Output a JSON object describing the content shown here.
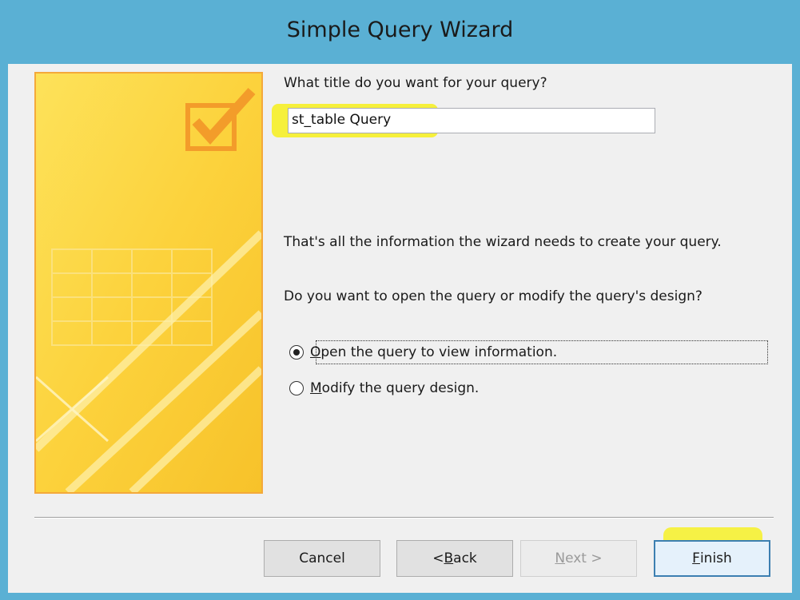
{
  "window": {
    "title": "Simple Query Wizard"
  },
  "prompt": "What title do you want for your query?",
  "query_title": {
    "value": "st_table Query"
  },
  "info": {
    "line1": "That's all the information the wizard needs to create your query.",
    "line2": "Do you want to open the query or modify the query's design?"
  },
  "options": [
    {
      "label_rest": "pen the query to view information.",
      "accel": "O",
      "selected": true
    },
    {
      "label_rest": "odify the query design.",
      "accel": "M",
      "selected": false
    }
  ],
  "buttons": {
    "cancel": "Cancel",
    "back_prefix": "< ",
    "back_accel": "B",
    "back_rest": "ack",
    "next_accel": "N",
    "next_rest": "ext >",
    "finish_accel": "F",
    "finish_rest": "inish"
  },
  "colors": {
    "titlebar": "#5ab0d4",
    "highlight": "#f6f03b",
    "art_border": "#f4a93a"
  }
}
